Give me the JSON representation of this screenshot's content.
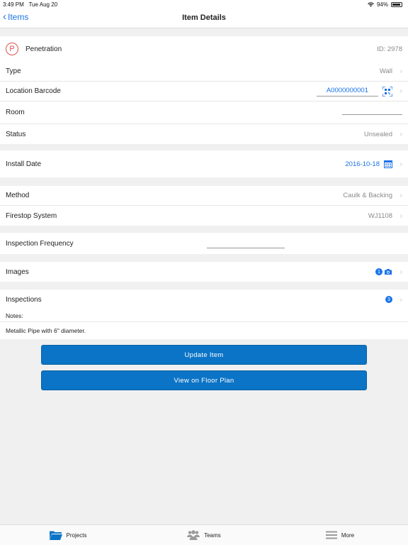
{
  "status": {
    "time": "3:49 PM",
    "date": "Tue Aug 20",
    "battery": "94%"
  },
  "nav": {
    "back_label": "Items",
    "title": "Item Details"
  },
  "header": {
    "badge": "P",
    "type_name": "Penetration",
    "id_text": "ID: 2978"
  },
  "fields": {
    "type": {
      "label": "Type",
      "value": "Wall"
    },
    "location_barcode": {
      "label": "Location Barcode",
      "value": "A0000000001"
    },
    "room": {
      "label": "Room",
      "value": ""
    },
    "status": {
      "label": "Status",
      "value": "Unsealed"
    },
    "install_date": {
      "label": "Install Date",
      "value": "2016-10-18"
    },
    "method": {
      "label": "Method",
      "value": "Caulk & Backing"
    },
    "firestop_system": {
      "label": "Firestop System",
      "value": "WJ1108"
    },
    "inspection_frequency": {
      "label": "Inspection Frequency",
      "value": ""
    },
    "images": {
      "label": "Images",
      "count": "1"
    },
    "inspections": {
      "label": "Inspections",
      "count": "3"
    }
  },
  "notes": {
    "label": "Notes:",
    "text": "Metallic Pipe with 6\" diameter."
  },
  "buttons": {
    "update": "Update Item",
    "floor_plan": "View on Floor Plan"
  },
  "tabs": [
    {
      "label": "Projects",
      "icon": "folder-icon"
    },
    {
      "label": "Teams",
      "icon": "people-icon"
    },
    {
      "label": "More",
      "icon": "menu-icon"
    }
  ],
  "colors": {
    "accent": "#1a73e8",
    "button": "#0b74c6",
    "badge": "#d9534f"
  }
}
